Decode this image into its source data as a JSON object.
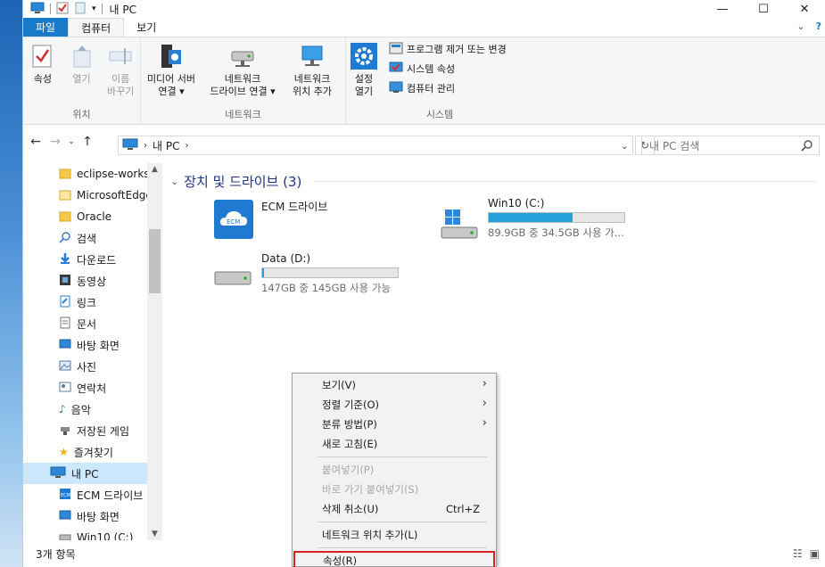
{
  "window": {
    "title": "내 PC",
    "controls": [
      "—",
      "☐",
      "✕"
    ]
  },
  "ribbon_tabs": {
    "file": "파일",
    "computer": "컴퓨터",
    "view": "보기"
  },
  "ribbon": {
    "location": {
      "label": "위치",
      "properties": "속성",
      "open": "열기",
      "rename": "이름\n바꾸기"
    },
    "network": {
      "label": "네트워크",
      "media_server": "미디어 서버\n연결 ▾",
      "map_drive": "네트워크\n드라이브 연결 ▾",
      "add_location": "네트워크\n위치 추가"
    },
    "system": {
      "label": "시스템",
      "settings": "설정\n열기",
      "uninstall": "프로그램 제거 또는 변경",
      "system_properties": "시스템 속성",
      "manage": "컴퓨터 관리"
    }
  },
  "address": {
    "path": "내 PC",
    "search_placeholder": "내 PC 검색"
  },
  "sidebar": {
    "items": [
      {
        "label": "eclipse-worksp",
        "icon": "folder-icon"
      },
      {
        "label": "MicrosoftEdge",
        "icon": "folder-icon"
      },
      {
        "label": "Oracle",
        "icon": "folder-icon"
      },
      {
        "label": "검색",
        "icon": "search-icon"
      },
      {
        "label": "다운로드",
        "icon": "download-icon"
      },
      {
        "label": "동영상",
        "icon": "video-icon"
      },
      {
        "label": "링크",
        "icon": "link-icon"
      },
      {
        "label": "문서",
        "icon": "document-icon"
      },
      {
        "label": "바탕 화면",
        "icon": "desktop-icon"
      },
      {
        "label": "사진",
        "icon": "picture-icon"
      },
      {
        "label": "연락처",
        "icon": "contact-icon"
      },
      {
        "label": "음악",
        "icon": "music-icon"
      },
      {
        "label": "저장된 게임",
        "icon": "game-icon"
      },
      {
        "label": "즐겨찾기",
        "icon": "star-icon"
      },
      {
        "label": "내 PC",
        "icon": "pc-icon"
      },
      {
        "label": "ECM 드라이브",
        "icon": "ecm-icon"
      },
      {
        "label": "바탕 화면",
        "icon": "desktop-icon"
      },
      {
        "label": "Win10 (C:)",
        "icon": "drive-icon"
      }
    ]
  },
  "content": {
    "section_title": "장치 및 드라이브 (3)",
    "drives": [
      {
        "name": "ECM 드라이브",
        "icon": "ecm-cloud-icon"
      },
      {
        "name": "Win10 (C:)",
        "usage": "89.9GB 중 34.5GB 사용 가...",
        "fill": 0.62,
        "icon": "windows-drive-icon"
      },
      {
        "name": "Data (D:)",
        "usage": "147GB 중 145GB 사용 가능",
        "fill": 0.014,
        "icon": "drive-icon"
      }
    ]
  },
  "context_menu": {
    "view": "보기(V)",
    "sort": "정렬 기준(O)",
    "group": "분류 방법(P)",
    "refresh": "새로 고침(E)",
    "paste": "붙여넣기(P)",
    "paste_shortcut": "바로 가기 붙여넣기(S)",
    "undo": "삭제 취소(U)",
    "undo_shortcut": "Ctrl+Z",
    "add_network_location": "네트워크 위치 추가(L)",
    "properties": "속성(R)"
  },
  "status": {
    "count": "3개 항목"
  },
  "colors": {
    "accent": "#1979ca",
    "bar_fill": "#26a0da",
    "highlight_border": "#e02020"
  }
}
